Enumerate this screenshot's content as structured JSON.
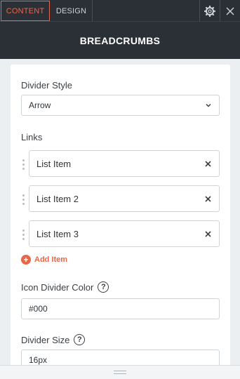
{
  "tabs": {
    "content": "CONTENT",
    "design": "DESIGN"
  },
  "toolbar": {
    "settings_icon": "gear-icon",
    "close_icon": "close-icon"
  },
  "header": {
    "title": "BREADCRUMBS"
  },
  "divider_style": {
    "label": "Divider Style",
    "value": "Arrow"
  },
  "links": {
    "label": "Links",
    "items": [
      "List Item",
      "List Item 2",
      "List Item 3"
    ],
    "add_label": "Add Item"
  },
  "icon_divider_color": {
    "label": "Icon Divider Color",
    "value": "#000"
  },
  "divider_size": {
    "label": "Divider Size",
    "value": "16px"
  },
  "colors": {
    "accent": "#e9664a",
    "dark": "#2b3036"
  }
}
